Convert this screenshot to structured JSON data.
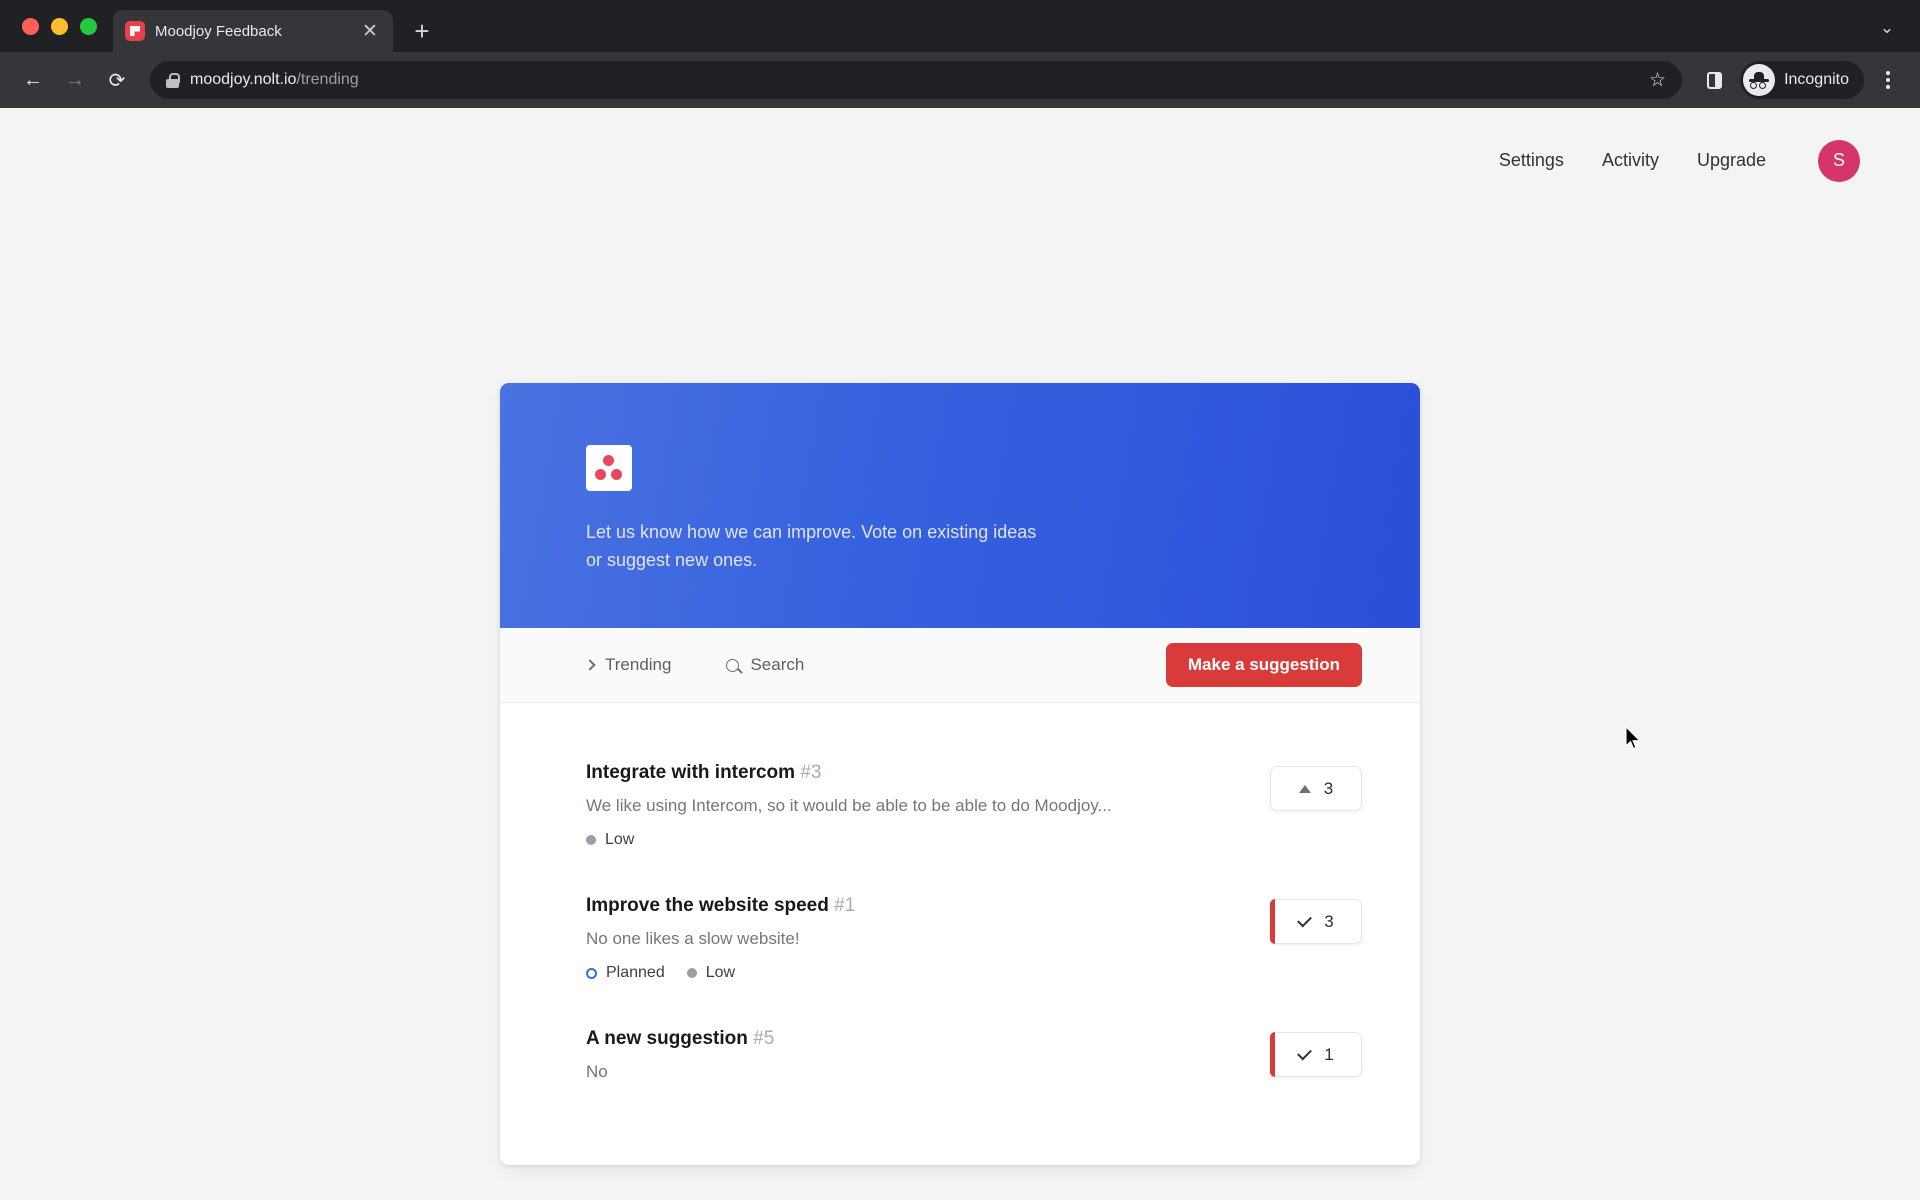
{
  "browser": {
    "tab": {
      "title": "Moodjoy Feedback",
      "favicon": "moodjoy-favicon",
      "close_label": "✕"
    },
    "new_tab_label": "+",
    "tab_list_label": "⌄",
    "back_label": "←",
    "forward_label": "→",
    "reload_label": "⟳",
    "url_domain": "moodjoy.nolt.io",
    "url_path": "/trending",
    "bookmark_label": "☆",
    "profile_label": "Incognito",
    "menu_label": "kebab-menu"
  },
  "pagenav": {
    "links": [
      {
        "label": "Settings"
      },
      {
        "label": "Activity"
      },
      {
        "label": "Upgrade"
      }
    ],
    "avatar_initial": "S",
    "avatar_color": "#d4356b"
  },
  "banner": {
    "tagline": "Let us know how we can improve. Vote on existing ideas or suggest new ones.",
    "gradient_from": "#4a72e0",
    "gradient_to": "#2a4fd8",
    "logo_name": "moodjoy-logo",
    "logo_dot_color": "#ea4660"
  },
  "cardbar": {
    "sort_label": "Trending",
    "search_label": "Search",
    "cta_label": "Make a suggestion",
    "cta_color": "#d93b3b"
  },
  "list": {
    "items": [
      {
        "title": "Integrate with intercom",
        "number": "#3",
        "description": "We like using Intercom, so it would be able to be able to do Moodjoy...",
        "tags": [
          {
            "label": "Low",
            "type": "dot",
            "color": "#9a9fa4"
          }
        ],
        "vote": {
          "count": "3",
          "voted": false,
          "glyph": "upvote-triangle"
        }
      },
      {
        "title": "Improve the website speed",
        "number": "#1",
        "description": "No one likes a slow website!",
        "tags": [
          {
            "label": "Planned",
            "type": "ring",
            "color": "#2f6fe0"
          },
          {
            "label": "Low",
            "type": "dot",
            "color": "#9a9fa4"
          }
        ],
        "vote": {
          "count": "3",
          "voted": true,
          "glyph": "check"
        }
      },
      {
        "title": "A new suggestion",
        "number": "#5",
        "description": "No",
        "tags": [],
        "vote": {
          "count": "1",
          "voted": true,
          "glyph": "check"
        }
      }
    ]
  }
}
